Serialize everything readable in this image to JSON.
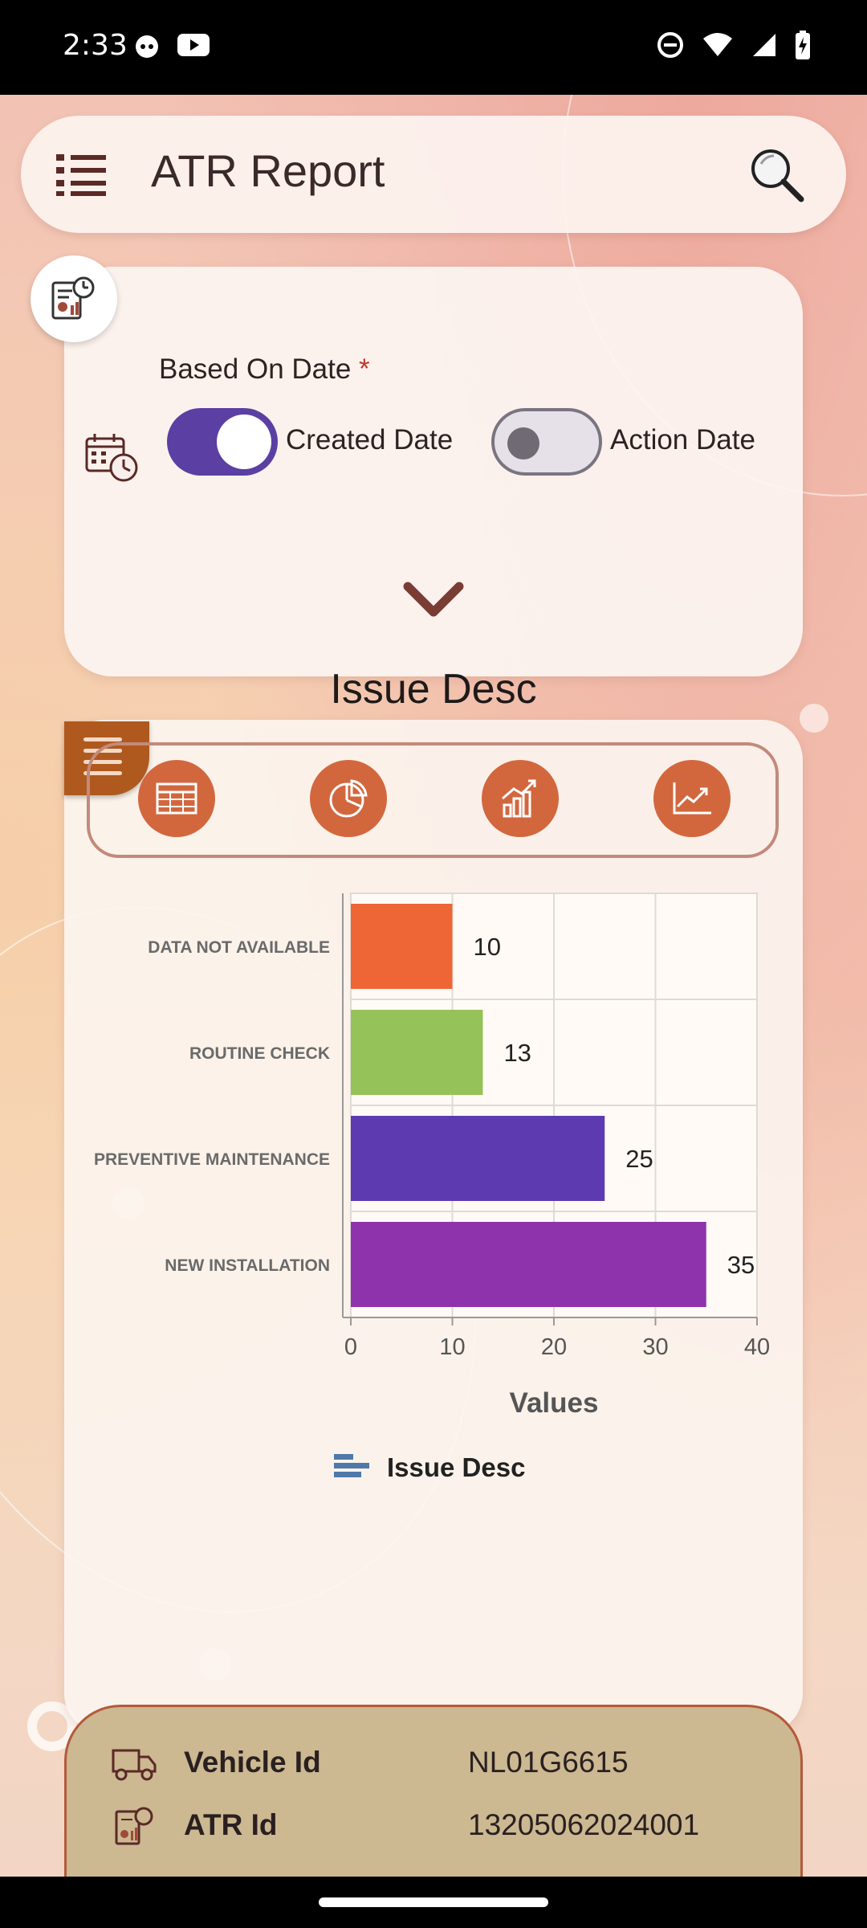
{
  "status_bar": {
    "time": "2:33"
  },
  "app_bar": {
    "title": "ATR Report"
  },
  "filter": {
    "based_on_label": "Based On Date",
    "required_marker": "*",
    "option_created": "Created Date",
    "option_action": "Action Date",
    "created_date_on": true,
    "action_date_on": false
  },
  "chart_card": {
    "title": "Issue Desc",
    "chart_types": [
      "table-icon",
      "pie-chart-icon",
      "bar-chart-icon",
      "line-chart-icon"
    ]
  },
  "chart_data": {
    "type": "bar",
    "orientation": "horizontal",
    "categories": [
      "DATA NOT AVAILABLE",
      "ROUTINE CHECK",
      "PREVENTIVE MAINTENANCE",
      "NEW INSTALLATION"
    ],
    "values": [
      10,
      13,
      25,
      35
    ],
    "colors": [
      "#ee6536",
      "#96c25a",
      "#5e3ab0",
      "#8e33ac"
    ],
    "xlabel": "Values",
    "xlim": [
      0,
      40
    ],
    "xticks": [
      "0",
      "10",
      "20",
      "30",
      "40"
    ],
    "grid": true,
    "legend": "Issue Desc",
    "legend_placement": "bottom-center",
    "legend_color": "#4f79a8"
  },
  "details": {
    "vehicle_label": "Vehicle Id",
    "vehicle_value": "NL01G6615",
    "atr_label": "ATR Id",
    "atr_value": "13205062024001"
  }
}
